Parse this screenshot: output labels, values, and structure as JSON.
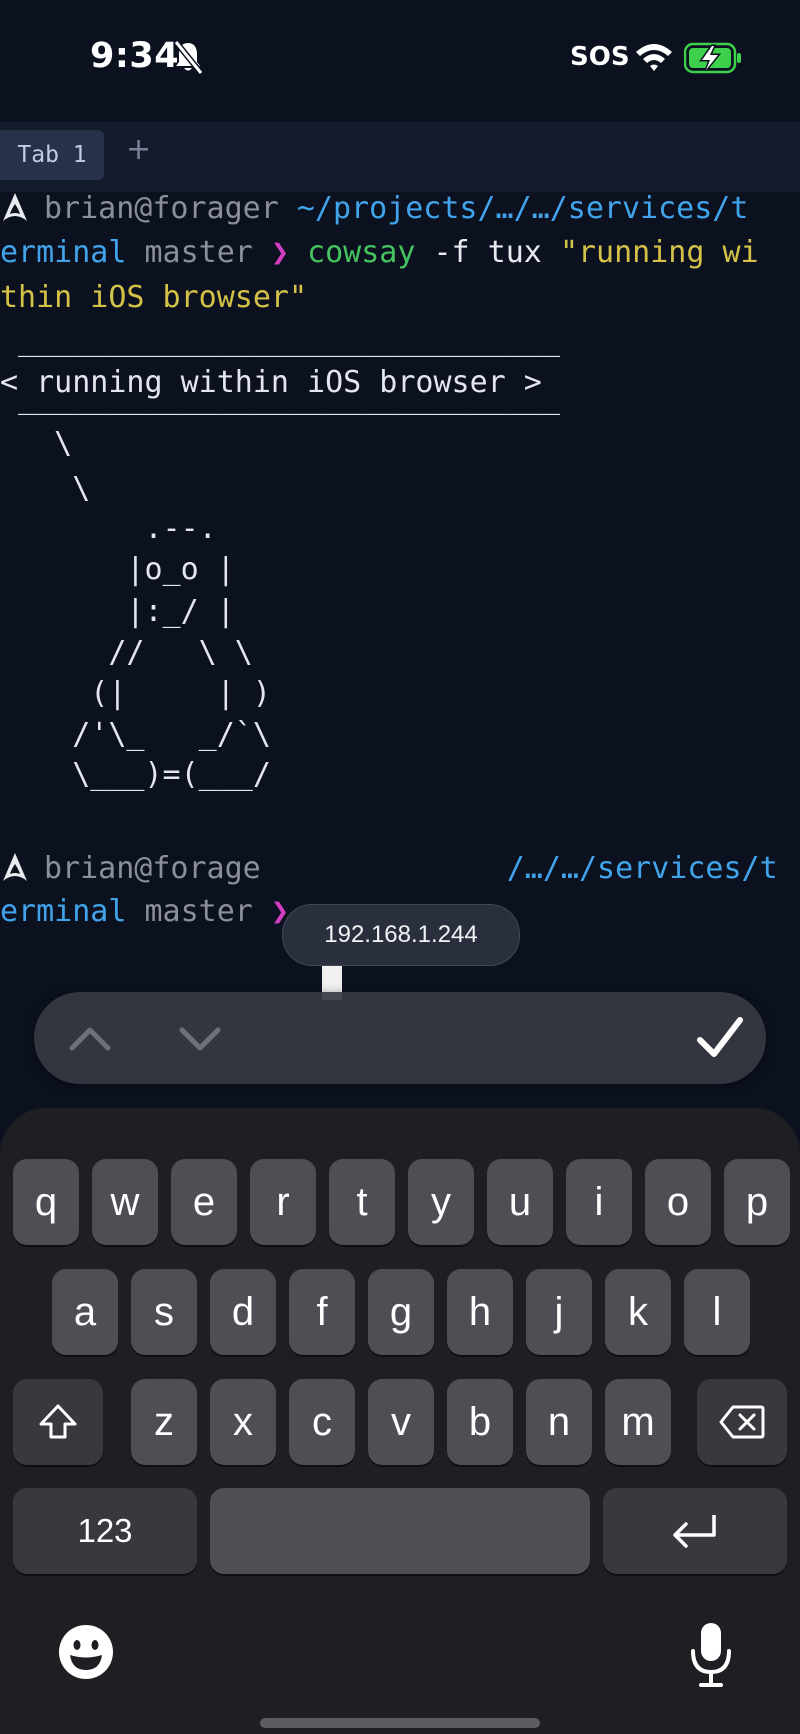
{
  "status_bar": {
    "time": "9:34",
    "carrier": "SOS",
    "icons": [
      "bell-slash-icon",
      "wifi-icon",
      "battery-charging-icon"
    ],
    "battery_color": "#3ed04b"
  },
  "tabs": {
    "items": [
      {
        "label": "Tab 1",
        "active": true
      }
    ],
    "new_tab_label": "+"
  },
  "terminal": {
    "colors": {
      "background": "#0c1120",
      "user": "#8a8f99",
      "path": "#41a4ea",
      "prompt_symbol": "#d13ec2",
      "command": "#44c35f",
      "string": "#d4c247"
    },
    "prompt1": {
      "user_host": "brian@forager",
      "path_line1": "~/projects/…/…/services/t",
      "path_line2": "erminal",
      "branch": "master",
      "symbol": "❯",
      "command": "cowsay",
      "args": "-f tux",
      "string_line1": "\"running wi",
      "string_line2": "thin iOS browser\""
    },
    "output": [
      " ______________________________",
      "< running within iOS browser >",
      " ______________________________",
      "   \\",
      "    \\",
      "        .--.",
      "       |o_o |",
      "       |:_/ |",
      "      //   \\ \\",
      "     (|     | )",
      "    /'\\_   _/`\\",
      "    \\___)=(___/"
    ],
    "prompt2": {
      "user_host": "brian@forage",
      "path_line1": "/…/…/services/t",
      "path_line2": "erminal",
      "branch": "master",
      "symbol": "❯"
    },
    "ip_address": "192.168.1.244"
  },
  "accessory_bar": {
    "prev_icon": "chevron-up-icon",
    "next_icon": "chevron-down-icon",
    "done_icon": "checkmark-icon"
  },
  "keyboard": {
    "row1": [
      "q",
      "w",
      "e",
      "r",
      "t",
      "y",
      "u",
      "i",
      "o",
      "p"
    ],
    "row2": [
      "a",
      "s",
      "d",
      "f",
      "g",
      "h",
      "j",
      "k",
      "l"
    ],
    "row3": [
      "z",
      "x",
      "c",
      "v",
      "b",
      "n",
      "m"
    ],
    "numbers_label": "123",
    "space_label": "",
    "shift_icon": "shift-icon",
    "delete_icon": "delete-icon",
    "return_icon": "return-icon",
    "emoji_icon": "emoji-icon",
    "mic_icon": "microphone-icon"
  }
}
